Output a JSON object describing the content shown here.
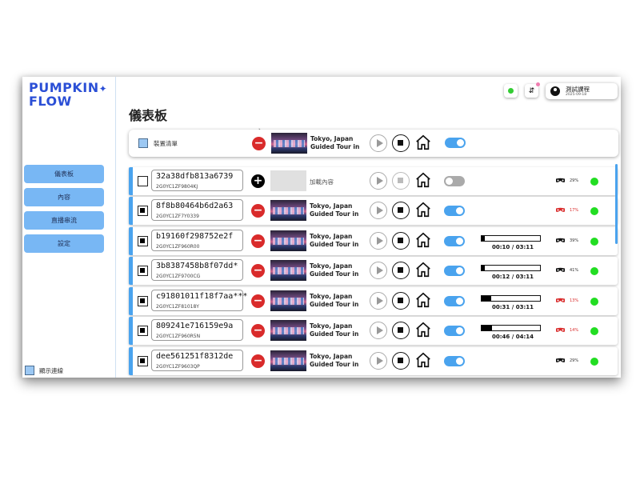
{
  "logo": {
    "line1": "PUMPKIN",
    "line2": "FLOW",
    "star": "✦"
  },
  "nav": [
    {
      "label": "儀表板"
    },
    {
      "label": "內容"
    },
    {
      "label": "直播串流"
    },
    {
      "label": "設定"
    }
  ],
  "show_connection": "顯示連線",
  "page_title": "儀表板",
  "user": {
    "name": "測試課程",
    "date": "2025-09-18"
  },
  "header_icons": {
    "status": "green-dot-icon",
    "sort": "sort-icon",
    "sort_glyph": "⇵"
  },
  "master": {
    "label": "裝置清單",
    "video_line1": "Tokyo, Japan",
    "video_line2": "Guided Tour in"
  },
  "load_content": "加載內容",
  "devices": [
    {
      "id": "32a38dfb813a6739",
      "serial": "2G0YC1ZF9804KJ",
      "checked": false,
      "empty": true,
      "toggle_on": false,
      "progress": null,
      "time": "",
      "battery": "29%",
      "low": false
    },
    {
      "id": "8f8b80464b6d2a63",
      "serial": "2G0YC1ZF7Y0339",
      "checked": true,
      "empty": false,
      "video_line1": "Tokyo, Japan",
      "video_line2": "Guided Tour in",
      "toggle_on": true,
      "progress": null,
      "time": "",
      "battery": "17%",
      "low": true
    },
    {
      "id": "b19160f298752e2f",
      "serial": "2G0YC1ZF960R00",
      "checked": true,
      "empty": false,
      "video_line1": "Tokyo, Japan",
      "video_line2": "Guided Tour in",
      "toggle_on": true,
      "progress": 0.05,
      "time": "00:10 / 03:11",
      "battery": "39%",
      "low": false
    },
    {
      "id": "3b8387458b8f07dd*",
      "serial": "2G0YC1ZF9700CG",
      "checked": true,
      "empty": false,
      "video_line1": "Tokyo, Japan",
      "video_line2": "Guided Tour in",
      "toggle_on": true,
      "progress": 0.06,
      "time": "00:12 / 03:11",
      "battery": "41%",
      "low": false
    },
    {
      "id": "c91801011f18f7aa***",
      "serial": "2G0YC1ZF81018Y",
      "checked": true,
      "empty": false,
      "video_line1": "Tokyo, Japan",
      "video_line2": "Guided Tour in",
      "toggle_on": true,
      "progress": 0.16,
      "time": "00:31 / 03:11",
      "battery": "13%",
      "low": true
    },
    {
      "id": "809241e716159e9a",
      "serial": "2G0YC1ZF960R5N",
      "checked": true,
      "empty": false,
      "video_line1": "Tokyo, Japan",
      "video_line2": "Guided Tour in",
      "toggle_on": true,
      "progress": 0.18,
      "time": "00:46 / 04:14",
      "battery": "14%",
      "low": true
    },
    {
      "id": "dee561251f8312de",
      "serial": "2G0YC1ZF9603QP",
      "checked": true,
      "empty": false,
      "video_line1": "Tokyo, Japan",
      "video_line2": "Guided Tour in",
      "toggle_on": true,
      "progress": null,
      "time": "",
      "battery": "29%",
      "low": false
    }
  ],
  "colors": {
    "accent": "#4aa3ee",
    "nav_bg": "#78b7f4",
    "logo": "#2b4fd6",
    "danger": "#d92b2b",
    "online": "#22dd22"
  }
}
